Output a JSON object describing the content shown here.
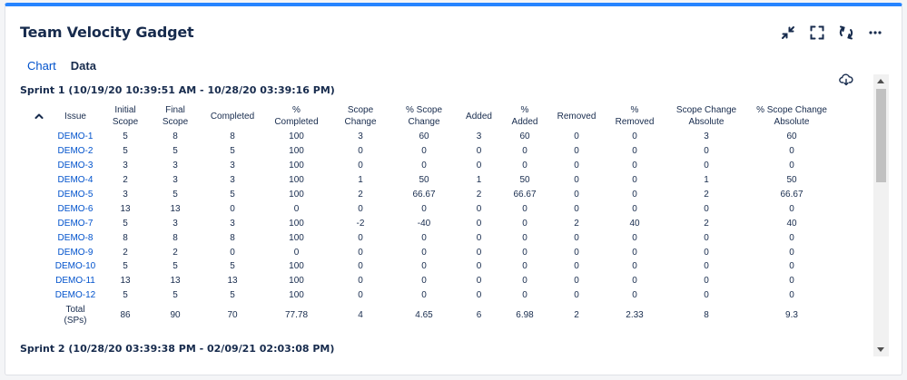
{
  "gadget": {
    "title": "Team Velocity Gadget",
    "actions": [
      "minimize-icon",
      "fullscreen-icon",
      "refresh-icon",
      "more-icon"
    ],
    "accent_color": "#2684ff"
  },
  "tabs": [
    {
      "label": "Chart",
      "active": false
    },
    {
      "label": "Data",
      "active": true
    }
  ],
  "sprints": [
    {
      "label": "Sprint 1 (10/19/20 10:39:51 AM - 10/28/20 03:39:16 PM)"
    },
    {
      "label": "Sprint 2 (10/28/20 03:39:38 PM - 02/09/21 02:03:08 PM)"
    }
  ],
  "table": {
    "headers": [
      "Issue",
      "Initial\nScope",
      "Final\nScope",
      "Completed",
      "%\nCompleted",
      "Scope\nChange",
      "% Scope\nChange",
      "Added",
      "%\nAdded",
      "Removed",
      "%\nRemoved",
      "Scope Change\nAbsolute",
      "% Scope Change\nAbsolute"
    ],
    "rows": [
      [
        "DEMO-1",
        "5",
        "8",
        "8",
        "100",
        "3",
        "60",
        "3",
        "60",
        "0",
        "0",
        "3",
        "60"
      ],
      [
        "DEMO-2",
        "5",
        "5",
        "5",
        "100",
        "0",
        "0",
        "0",
        "0",
        "0",
        "0",
        "0",
        "0"
      ],
      [
        "DEMO-3",
        "3",
        "3",
        "3",
        "100",
        "0",
        "0",
        "0",
        "0",
        "0",
        "0",
        "0",
        "0"
      ],
      [
        "DEMO-4",
        "2",
        "3",
        "3",
        "100",
        "1",
        "50",
        "1",
        "50",
        "0",
        "0",
        "1",
        "50"
      ],
      [
        "DEMO-5",
        "3",
        "5",
        "5",
        "100",
        "2",
        "66.67",
        "2",
        "66.67",
        "0",
        "0",
        "2",
        "66.67"
      ],
      [
        "DEMO-6",
        "13",
        "13",
        "0",
        "0",
        "0",
        "0",
        "0",
        "0",
        "0",
        "0",
        "0",
        "0"
      ],
      [
        "DEMO-7",
        "5",
        "3",
        "3",
        "100",
        "-2",
        "-40",
        "0",
        "0",
        "2",
        "40",
        "2",
        "40"
      ],
      [
        "DEMO-8",
        "8",
        "8",
        "8",
        "100",
        "0",
        "0",
        "0",
        "0",
        "0",
        "0",
        "0",
        "0"
      ],
      [
        "DEMO-9",
        "2",
        "2",
        "0",
        "0",
        "0",
        "0",
        "0",
        "0",
        "0",
        "0",
        "0",
        "0"
      ],
      [
        "DEMO-10",
        "5",
        "5",
        "5",
        "100",
        "0",
        "0",
        "0",
        "0",
        "0",
        "0",
        "0",
        "0"
      ],
      [
        "DEMO-11",
        "13",
        "13",
        "13",
        "100",
        "0",
        "0",
        "0",
        "0",
        "0",
        "0",
        "0",
        "0"
      ],
      [
        "DEMO-12",
        "5",
        "5",
        "5",
        "100",
        "0",
        "0",
        "0",
        "0",
        "0",
        "0",
        "0",
        "0"
      ]
    ],
    "total": [
      "Total\n(SPs)",
      "86",
      "90",
      "70",
      "77.78",
      "4",
      "4.65",
      "6",
      "6.98",
      "2",
      "2.33",
      "8",
      "9.3"
    ]
  }
}
